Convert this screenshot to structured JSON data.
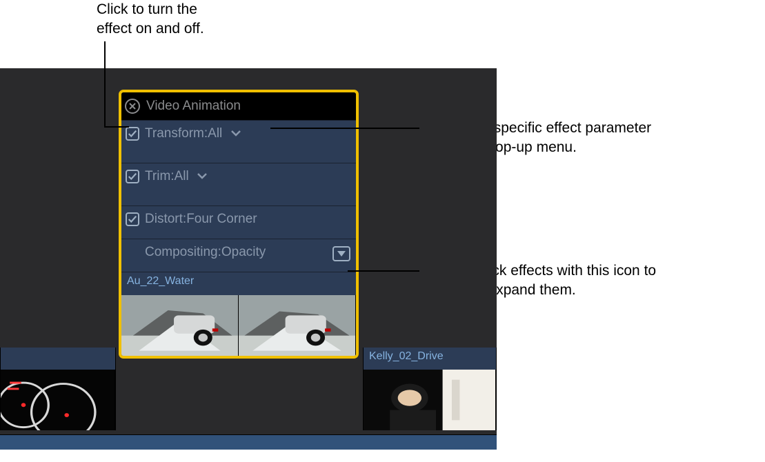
{
  "callouts": {
    "top": "Click to turn the effect on and off.",
    "right1": "Choose a specific effect parameter from this pop-up menu.",
    "right2": "Double-click effects with this icon to vertically expand them."
  },
  "panel": {
    "title": "Video Animation",
    "rows": {
      "transform": {
        "name": "Transform:",
        "param": "All"
      },
      "trim": {
        "name": "Trim:",
        "param": "All"
      },
      "distort": {
        "name": "Distort:",
        "param": "Four Corner"
      },
      "compositing": {
        "name": "Compositing:",
        "param": "Opacity"
      }
    }
  },
  "clips": {
    "left_partial": "",
    "au_water": "Au_22_Water",
    "kelly_drive": "Kelly_02_Drive"
  }
}
